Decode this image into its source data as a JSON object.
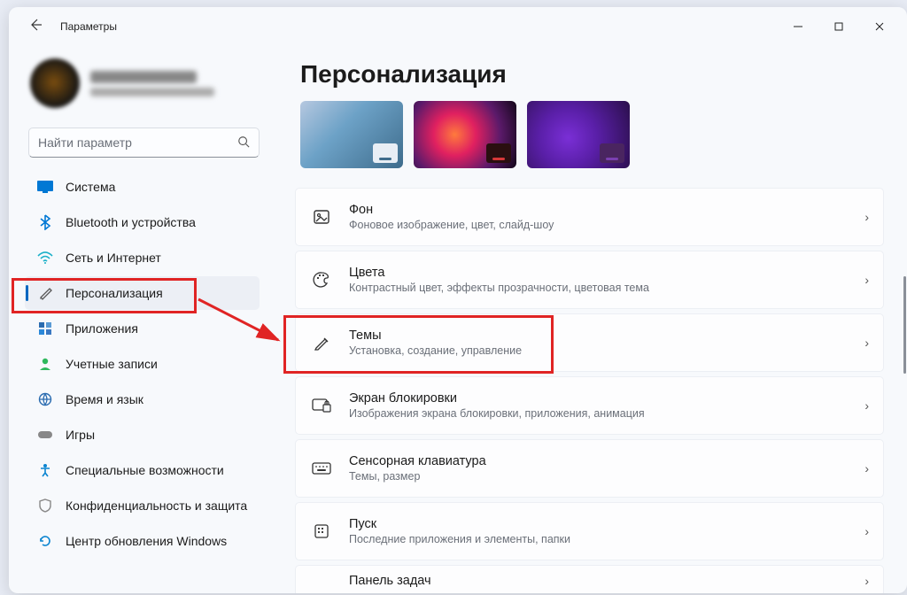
{
  "window": {
    "title": "Параметры"
  },
  "search": {
    "placeholder": "Найти параметр"
  },
  "sidebar": {
    "items": [
      {
        "label": "Система"
      },
      {
        "label": "Bluetooth и устройства"
      },
      {
        "label": "Сеть и Интернет"
      },
      {
        "label": "Персонализация"
      },
      {
        "label": "Приложения"
      },
      {
        "label": "Учетные записи"
      },
      {
        "label": "Время и язык"
      },
      {
        "label": "Игры"
      },
      {
        "label": "Специальные возможности"
      },
      {
        "label": "Конфиденциальность и защита"
      },
      {
        "label": "Центр обновления Windows"
      }
    ]
  },
  "page": {
    "title": "Персонализация"
  },
  "rows": [
    {
      "title": "Фон",
      "sub": "Фоновое изображение, цвет, слайд-шоу"
    },
    {
      "title": "Цвета",
      "sub": "Контрастный цвет, эффекты прозрачности, цветовая тема"
    },
    {
      "title": "Темы",
      "sub": "Установка, создание, управление"
    },
    {
      "title": "Экран блокировки",
      "sub": "Изображения экрана блокировки, приложения, анимация"
    },
    {
      "title": "Сенсорная клавиатура",
      "sub": "Темы, размер"
    },
    {
      "title": "Пуск",
      "sub": "Последние приложения и элементы, папки"
    },
    {
      "title": "Панель задач",
      "sub": ""
    }
  ]
}
